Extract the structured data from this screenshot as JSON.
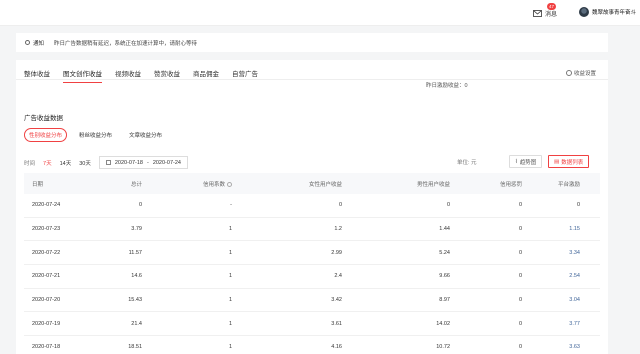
{
  "topbar": {
    "messages_label": "消息",
    "messages_badge": "47",
    "user_name": "魏翠故事青年奋斗"
  },
  "notice": {
    "label": "通知",
    "text": "昨日广告数据稍有延迟，系统正在加速计算中，请耐心等待"
  },
  "tabs": [
    "整体收益",
    "图文创作收益",
    "视频收益",
    "赞赏收益",
    "商品佣金",
    "自营广告"
  ],
  "settings_label": "收益设置",
  "yesterday_label": "昨日激励收益：0",
  "section_title": "广告收益数据",
  "subtabs": [
    "性别收益分布",
    "粉丝收益分布",
    "文章收益分布"
  ],
  "filters": {
    "time_label": "时间",
    "ranges": [
      "7天",
      "14天",
      "30天"
    ],
    "start_date": "2020-07-18",
    "separator": "-",
    "end_date": "2020-07-24",
    "unit_label": "单位: 元",
    "trend_button": "趋势图",
    "list_button": "数据列表"
  },
  "table": {
    "headers": [
      "日期",
      "总计",
      "信用系数",
      "女性用户收益",
      "男性用户收益",
      "信用惩罚",
      "平台激励"
    ],
    "rows": [
      [
        "2020-07-24",
        "0",
        "-",
        "0",
        "0",
        "0",
        "0"
      ],
      [
        "2020-07-23",
        "3.79",
        "1",
        "1.2",
        "1.44",
        "0",
        "1.15"
      ],
      [
        "2020-07-22",
        "11.57",
        "1",
        "2.99",
        "5.24",
        "0",
        "3.34"
      ],
      [
        "2020-07-21",
        "14.6",
        "1",
        "2.4",
        "9.66",
        "0",
        "2.54"
      ],
      [
        "2020-07-20",
        "15.43",
        "1",
        "3.42",
        "8.97",
        "0",
        "3.04"
      ],
      [
        "2020-07-19",
        "21.4",
        "1",
        "3.61",
        "14.02",
        "0",
        "3.77"
      ],
      [
        "2020-07-18",
        "18.51",
        "1",
        "4.16",
        "10.72",
        "0",
        "3.63"
      ]
    ]
  },
  "colors": {
    "accent": "#f04142",
    "link_blue": "#406599"
  }
}
